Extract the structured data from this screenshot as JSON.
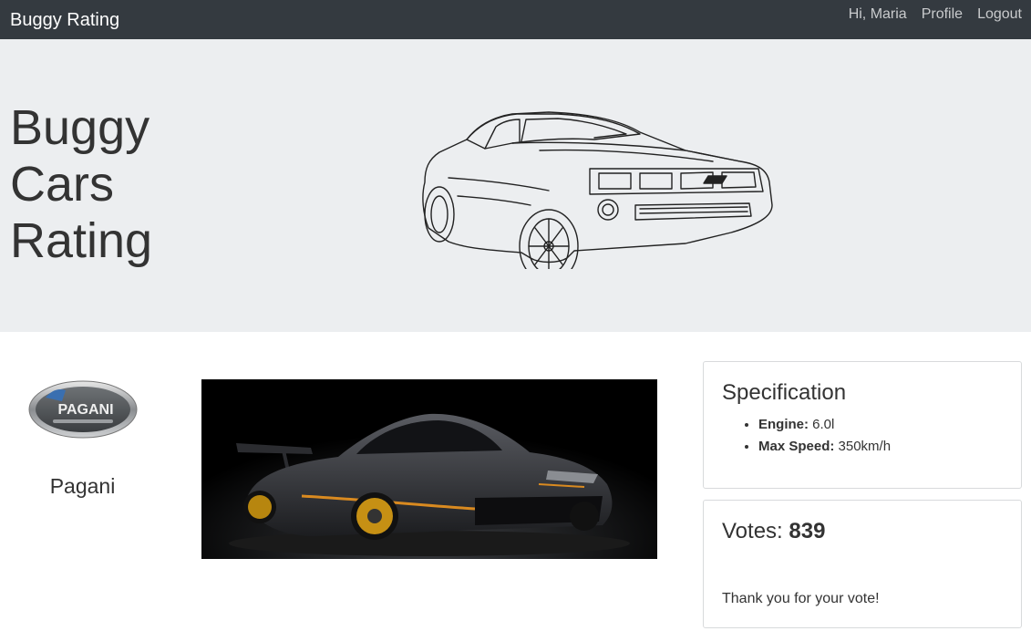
{
  "navbar": {
    "brand": "Buggy Rating",
    "greeting": "Hi, Maria",
    "profile_link": "Profile",
    "logout_link": "Logout"
  },
  "hero": {
    "title_lines": [
      "Buggy",
      "Cars",
      "Rating"
    ],
    "image": "car-outline-drawing"
  },
  "car": {
    "make_name": "Pagani",
    "make_logo_text": "PAGANI",
    "photo": "pagani-zonda-black-photo"
  },
  "specification": {
    "heading": "Specification",
    "items": [
      {
        "label": "Engine:",
        "value": "6.0l"
      },
      {
        "label": "Max Speed:",
        "value": "350km/h"
      }
    ]
  },
  "votes": {
    "label": "Votes:",
    "count": "839",
    "message": "Thank you for your vote!"
  },
  "colors": {
    "navbar_bg": "#343a40",
    "hero_bg": "#eceef0",
    "nav_link": "#c9cbcd"
  }
}
